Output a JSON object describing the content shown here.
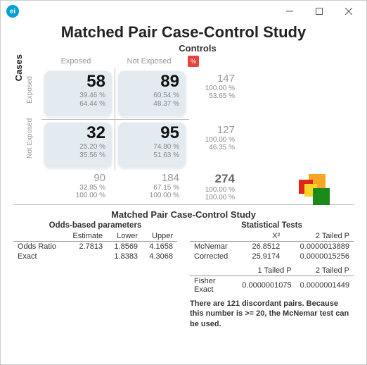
{
  "window": {
    "title": ""
  },
  "page_title": "Matched Pair Case-Control Study",
  "axes": {
    "controls": "Controls",
    "cases": "Cases",
    "exposed": "Exposed",
    "not_exposed": "Not Exposed",
    "percent_badge": "%"
  },
  "cells": {
    "a": {
      "n": "58",
      "row_pct": "39.46 %",
      "col_pct": "64.44 %"
    },
    "b": {
      "n": "89",
      "row_pct": "60.54 %",
      "col_pct": "48.37 %"
    },
    "c": {
      "n": "32",
      "row_pct": "25.20 %",
      "col_pct": "35.56 %"
    },
    "d": {
      "n": "95",
      "row_pct": "74.80 %",
      "col_pct": "51.63 %"
    }
  },
  "row_totals": {
    "r1": {
      "n": "147",
      "p1": "100.00 %",
      "p2": "53.65 %"
    },
    "r2": {
      "n": "127",
      "p1": "100.00 %",
      "p2": "46.35 %"
    }
  },
  "col_totals": {
    "c1": {
      "n": "90",
      "p1": "32.85 %",
      "p2": "100.00 %"
    },
    "c2": {
      "n": "184",
      "p1": "67.15 %",
      "p2": "100.00 %"
    }
  },
  "grand": {
    "n": "274",
    "p1": "100.00 %",
    "p2": "100.00 %"
  },
  "subheading": "Matched Pair Case-Control Study",
  "odds": {
    "title": "Odds-based parameters",
    "headers": {
      "est": "Estimate",
      "low": "Lower",
      "up": "Upper"
    },
    "rows": {
      "odds_ratio": {
        "label": "Odds Ratio",
        "est": "2.7813",
        "low": "1.8569",
        "up": "4.1658"
      },
      "exact": {
        "label": "Exact",
        "est": "",
        "low": "1.8383",
        "up": "4.3068"
      }
    }
  },
  "tests": {
    "title": "Statistical Tests",
    "headers": {
      "x2": "X²",
      "p2t": "2 Tailed P",
      "p1t": "1 Tailed P"
    },
    "rows": {
      "mcnemar": {
        "label": "McNemar",
        "x2": "26.8512",
        "p": "0.0000013889"
      },
      "corrected": {
        "label": "Corrected",
        "x2": "25.9174",
        "p": "0.0000015256"
      },
      "fisher": {
        "label": "Fisher Exact",
        "p1": "0.0000001075",
        "p2": "0.0000001449"
      }
    }
  },
  "note": "There are 121 discordant pairs.  Because this number is  >= 20, the McNemar test can be used."
}
